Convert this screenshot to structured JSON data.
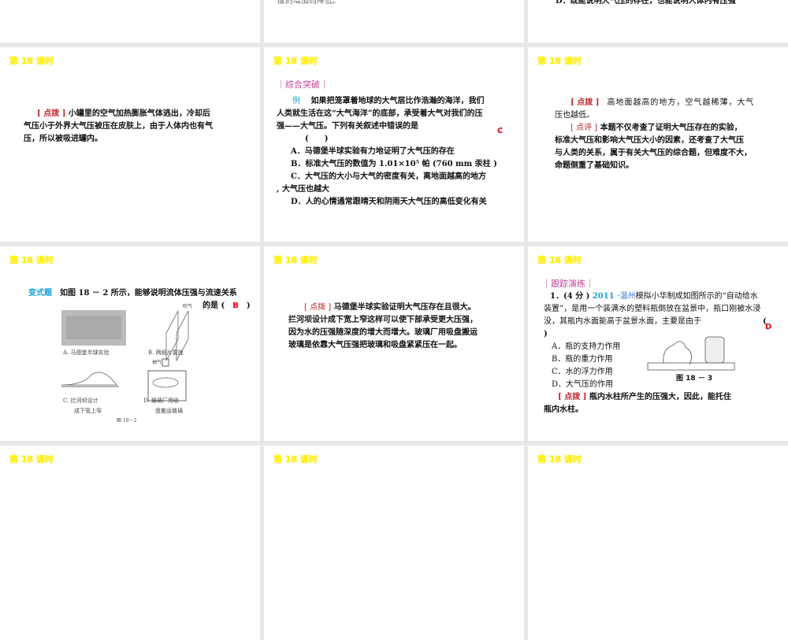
{
  "slides": [
    {
      "lines": []
    },
    {
      "lines": [
        "度的增加而降低。"
      ]
    },
    {
      "lines": [
        "D．既能说明大气压的存在，也能说明人体内有压强"
      ]
    },
    {
      "title": "第 18 课时",
      "tag": "[ 点拨 ]",
      "lines": [
        "小罐里的空气加热膨胀气体逃出，冷却后",
        "气压小于外界大气压被压在皮肤上，由于人体内也有气",
        "压，所以被吸进罐内。"
      ]
    },
    {
      "title": "第 18 课时",
      "section": "｜综合突破｜",
      "example": "例",
      "question": [
        "如果把笼罩着地球的大气层比作浩瀚的海洋，我们",
        "人类就生活在这“大气海洋”的底部，承受着大气对我们的压",
        "强——大气压。下列有关叙述中错误的是",
        "(　　)"
      ],
      "answer": "C",
      "options": [
        "A．马德堡半球实验有力地证明了大气压的存在",
        "B．标准大气压的数值为 1.01×10⁵ 帕 (760 mm 汞柱 )",
        "C．大气压的大小与大气的密度有关，离地面越高的地方",
        ", 大气压也越大",
        "D．人的心情通常跟晴天和阴雨天大气压的高低变化有关"
      ]
    },
    {
      "title": "第 18 课时",
      "tag1": "[ 点拨 ]",
      "line1": "高地面越高的地方，空气越稀薄，大气",
      "line2": "压也越低。",
      "tag2": "[ 点评 ]",
      "review": [
        "本题不仅考查了证明大气压存在的实验，",
        "标准大气压和影响大气压大小的因素，还考查了大气压",
        "与人类的关系，属于有关大气压的综合题，但难度不大，",
        "命题侧重了基础知识。"
      ]
    },
    {
      "title": "第 18 课时",
      "label": "变式题",
      "question": "如图 18 － 2 所示，能够说明流体压强与流速关系",
      "tail_open": "的是 (",
      "answer": "B",
      "tail_close": ")",
      "captions": [
        "A. 马德堡半球实验",
        "B. 两纸片靠拢",
        "C. 拦河坝设计",
        "成下宽上窄",
        "D. 玻璃厂用吸",
        "盘搬运玻璃",
        "图 18－2",
        "吹气",
        "抽气"
      ]
    },
    {
      "title": "第 18 课时",
      "tag": "[ 点拨 ]",
      "lines": [
        "马德堡半球实验证明大气压存在且很大。",
        "拦河坝设计成下宽上窄这样可以使下部承受更大压强，",
        "因为水的压强随深度的增大而增大。玻璃厂用吸盘搬运",
        "玻璃是依靠大气压强把玻璃和吸盘紧紧压在一起。"
      ]
    },
    {
      "title": "第 18 课时",
      "section": "｜跟踪演练｜",
      "num": "1．(4 分 )",
      "year": "2011 ·",
      "place": "温州",
      "q": [
        "模拟小华制成如图所示的“自动给水",
        "装置”，是用一个装满水的塑料瓶倒放在盆景中，瓶口刚被水浸",
        "没，其瓶内水面能高于盆景水面，主要是由于"
      ],
      "paren_open": "(",
      "paren_close": ")",
      "answer": "D",
      "options": [
        "A．瓶的支持力作用",
        "B．瓶的重力作用",
        "C．水的浮力作用",
        "D．大气压的作用"
      ],
      "figure": "图 18 － 3",
      "tag": "[ 点拨 ]",
      "note": [
        "瓶内水柱所产生的压强大，因此，能托住",
        "瓶内水柱。"
      ]
    },
    {
      "title": "第 18 课时"
    },
    {
      "title": "第 18 课时"
    },
    {
      "title": "第 18 课时"
    }
  ],
  "colors": {
    "title": "#ffef00",
    "section": "#c2409a",
    "tag": "#c0262d",
    "answer": "#e3001b"
  }
}
